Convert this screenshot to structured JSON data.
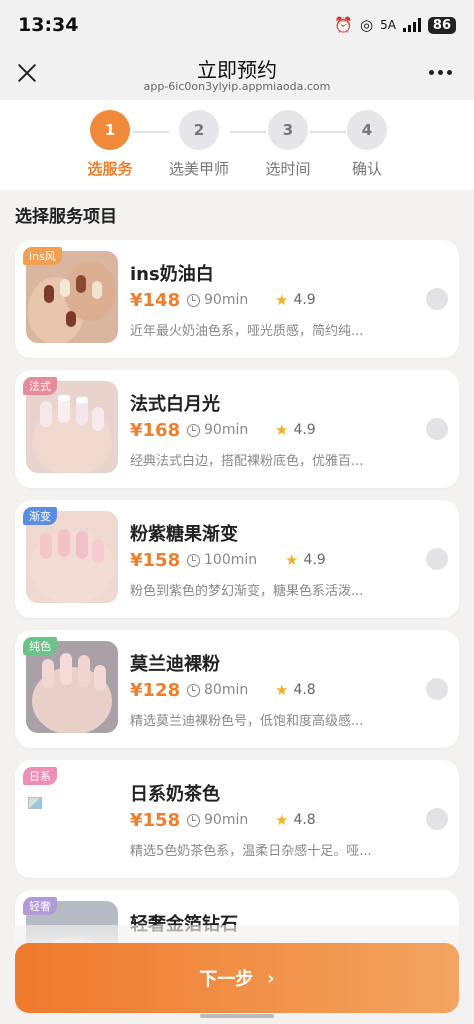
{
  "status_bar": {
    "time": "13:34",
    "network": "5A",
    "battery": "86"
  },
  "header": {
    "title": "立即预约",
    "subtitle": "app-6ic0on3ylyip.appmiaoda.com"
  },
  "steps": [
    {
      "number": "1",
      "label": "选服务",
      "active": true
    },
    {
      "number": "2",
      "label": "选美甲师",
      "active": false
    },
    {
      "number": "3",
      "label": "选时间",
      "active": false
    },
    {
      "number": "4",
      "label": "确认",
      "active": false
    }
  ],
  "section_title": "选择服务项目",
  "services": [
    {
      "tag": "ins风",
      "tag_color": "#f0a050",
      "name": "ins奶油白",
      "price": "¥148",
      "duration": "90min",
      "rating": "4.9",
      "desc": "近年最火奶油色系，哑光质感，简约纯..."
    },
    {
      "tag": "法式",
      "tag_color": "#e88a9a",
      "name": "法式白月光",
      "price": "¥168",
      "duration": "90min",
      "rating": "4.9",
      "desc": "经典法式白边，搭配裸粉底色，优雅百..."
    },
    {
      "tag": "渐变",
      "tag_color": "#5b8ee0",
      "name": "粉紫糖果渐变",
      "price": "¥158",
      "duration": "100min",
      "rating": "4.9",
      "desc": "粉色到紫色的梦幻渐变，糖果色系活泼..."
    },
    {
      "tag": "纯色",
      "tag_color": "#6cc38a",
      "name": "莫兰迪裸粉",
      "price": "¥128",
      "duration": "80min",
      "rating": "4.8",
      "desc": "精选莫兰迪裸粉色号，低饱和度高级感..."
    },
    {
      "tag": "日系",
      "tag_color": "#ee8fb5",
      "name": "日系奶茶色",
      "price": "¥158",
      "duration": "90min",
      "rating": "4.8",
      "desc": "精选5色奶茶色系，温柔日杂感十足。哑..."
    },
    {
      "tag": "轻奢",
      "tag_color": "#b09ad8",
      "name": "轻奢金箔钻石",
      "price": "",
      "duration": "",
      "rating": "",
      "desc": ""
    }
  ],
  "next_button": {
    "label": "下一步"
  },
  "colors": {
    "accent": "#ef7d2a",
    "star": "#f2b12b"
  }
}
